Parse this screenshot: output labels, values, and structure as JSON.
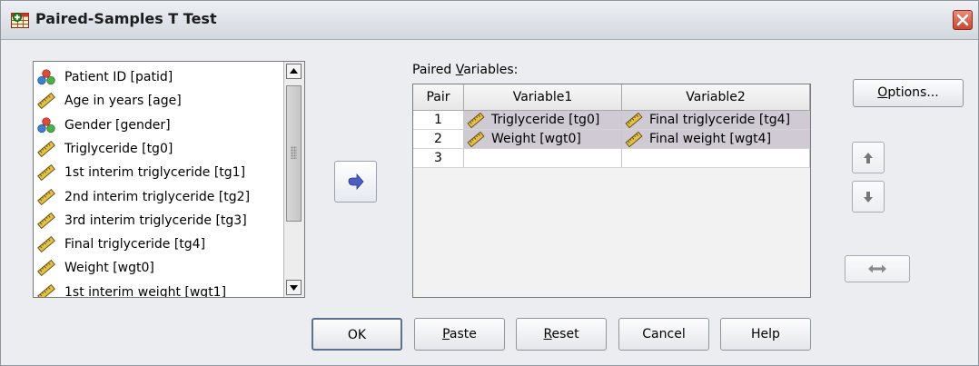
{
  "window": {
    "title": "Paired-Samples T Test"
  },
  "source_list": {
    "items": [
      {
        "label": "Patient ID [patid]",
        "icon": "nominal-icon"
      },
      {
        "label": "Age in years [age]",
        "icon": "scale-ruler-icon"
      },
      {
        "label": "Gender [gender]",
        "icon": "nominal-icon"
      },
      {
        "label": "Triglyceride [tg0]",
        "icon": "scale-ruler-icon"
      },
      {
        "label": "1st interim triglyceride [tg1]",
        "icon": "scale-ruler-icon"
      },
      {
        "label": "2nd interim triglyceride [tg2]",
        "icon": "scale-ruler-icon"
      },
      {
        "label": "3rd interim triglyceride [tg3]",
        "icon": "scale-ruler-icon"
      },
      {
        "label": "Final triglyceride [tg4]",
        "icon": "scale-ruler-icon"
      },
      {
        "label": "Weight [wgt0]",
        "icon": "scale-ruler-icon"
      },
      {
        "label": "1st interim weight [wgt1]",
        "icon": "scale-ruler-icon"
      }
    ]
  },
  "paired": {
    "label_prefix": "Paired ",
    "label_accel": "V",
    "label_suffix": "ariables:",
    "columns": [
      "Pair",
      "Variable1",
      "Variable2"
    ],
    "rows": [
      {
        "pair": "1",
        "var1": "Triglyceride [tg0]",
        "var2": "Final triglyceride [tg4]"
      },
      {
        "pair": "2",
        "var1": "Weight [wgt0]",
        "var2": "Final weight [wgt4]"
      },
      {
        "pair": "3",
        "var1": "",
        "var2": ""
      }
    ]
  },
  "buttons": {
    "options_accel": "O",
    "options_rest": "ptions...",
    "ok": "OK",
    "paste_accel": "P",
    "paste_rest": "aste",
    "reset_accel": "R",
    "reset_rest": "eset",
    "cancel": "Cancel",
    "help": "Help"
  },
  "colors": {
    "selected_row": "#cfcad4",
    "arrow_blue": "#4a5fc1"
  }
}
